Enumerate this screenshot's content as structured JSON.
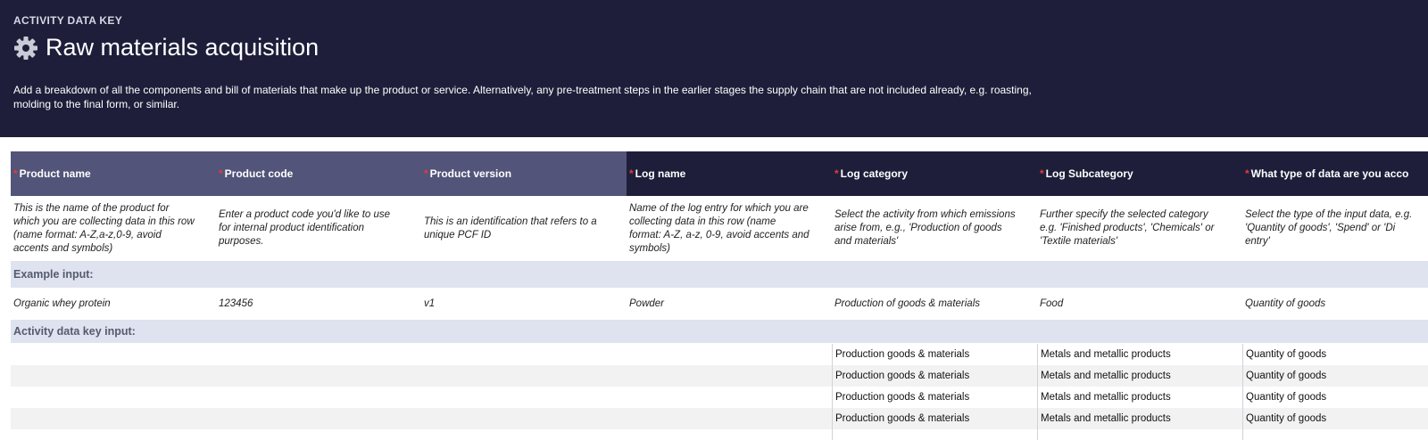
{
  "banner": {
    "kicker": "ACTIVITY DATA KEY",
    "icon": "gear-icon",
    "title": "Raw materials acquisition",
    "description": "Add a breakdown of all the components and bill of materials that make up the product or service. Alternatively, any pre-treatment steps in the earlier stages the supply chain that are not included already, e.g. roasting, molding to the final form, or similar."
  },
  "columns": [
    {
      "label": "Product name",
      "required": "*",
      "description": "This is the name of the product for which you are collecting data in this row (name format: A-Z,a-z,0-9, avoid accents and symbols)",
      "example": "Organic whey protein"
    },
    {
      "label": "Product code",
      "required": "*",
      "description": "Enter a product code you'd like to use for internal product identification purposes.",
      "example": "123456"
    },
    {
      "label": "Product version",
      "required": "*",
      "description": "This is an identification that refers to a unique PCF ID",
      "example": "v1"
    },
    {
      "label": "Log name",
      "required": "* ",
      "description": "Name of the log entry for which you are collecting data in this row (name format: A-Z, a-z, 0-9, avoid accents and symbols)",
      "example": "Powder"
    },
    {
      "label": "Log category",
      "required": "*",
      "description": "Select the activity from which emissions arise from, e.g., 'Production of goods and materials'",
      "example": "Production of goods & materials"
    },
    {
      "label": "Log Subcategory",
      "required": "*",
      "description": "Further specify the selected category e.g. 'Finished products', 'Chemicals' or 'Textile materials'",
      "example": "Food"
    },
    {
      "label": "What type of data are you acco",
      "required": "*",
      "description": "Select the type of the input data, e.g. 'Quantity of goods', 'Spend' or 'Di entry'",
      "example": "Quantity of goods"
    }
  ],
  "sections": {
    "example_label": "Example input:",
    "input_label": "Activity data key input:"
  },
  "input_rows": [
    {
      "category": "Production goods & materials",
      "subcategory": "Metals and metallic products",
      "type": "Quantity of goods"
    },
    {
      "category": "Production goods & materials",
      "subcategory": "Metals and metallic products",
      "type": "Quantity of goods"
    },
    {
      "category": "Production goods & materials",
      "subcategory": "Metals and metallic products",
      "type": "Quantity of goods"
    },
    {
      "category": "Production goods & materials",
      "subcategory": "Metals and metallic products",
      "type": "Quantity of goods"
    }
  ],
  "colors": {
    "banner": "#1e1e3a",
    "header_light": "#525479",
    "band": "#dfe3ef",
    "required": "#e23b3b"
  }
}
